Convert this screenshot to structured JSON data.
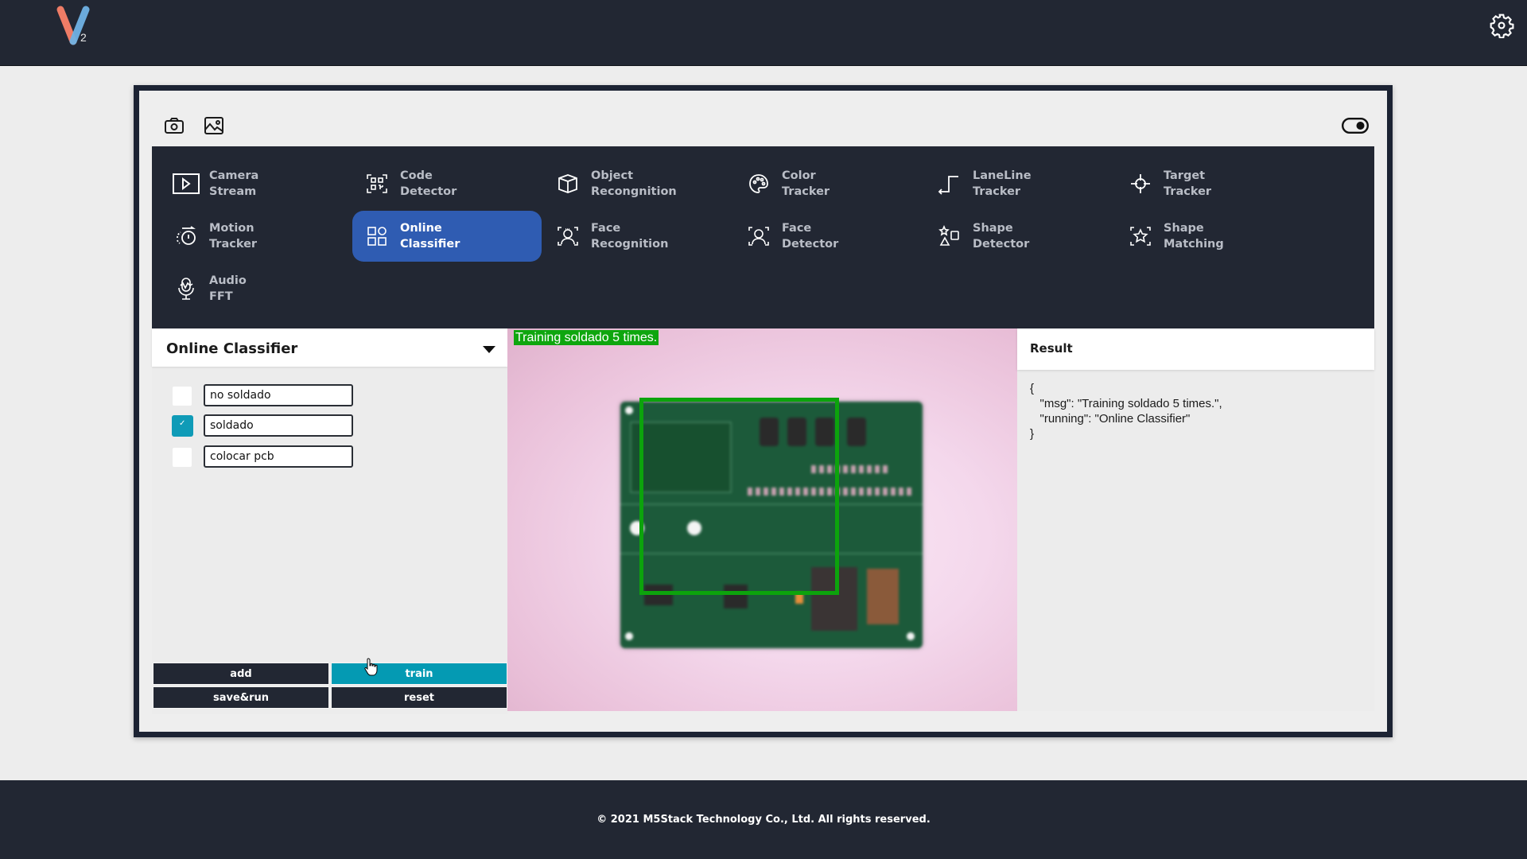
{
  "app": {
    "logo_letter": "V",
    "logo_sub": "2",
    "colors": {
      "topbar": "#222733",
      "accent_active": "#2f5cb2",
      "accent_teal": "#049ab3",
      "detect_green": "#0ca30c"
    }
  },
  "header": {
    "settings_icon": "gear-icon"
  },
  "toolbar": {
    "icons": [
      "camera-icon",
      "image-icon"
    ],
    "toggle_icon": "toggle-icon"
  },
  "menu": {
    "items": [
      {
        "label": "Camera\nStream",
        "icon": "play-screen-icon",
        "active": false
      },
      {
        "label": "Code\nDetector",
        "icon": "qr-code-icon",
        "active": false
      },
      {
        "label": "Object\nRecongnition",
        "icon": "cube-icon",
        "active": false
      },
      {
        "label": "Color\nTracker",
        "icon": "palette-icon",
        "active": false
      },
      {
        "label": "LaneLine\nTracker",
        "icon": "laneline-icon",
        "active": false
      },
      {
        "label": "Target\nTracker",
        "icon": "crosshair-icon",
        "active": false
      },
      {
        "label": "Motion\nTracker",
        "icon": "motion-icon",
        "active": false
      },
      {
        "label": "Online\nClassifier",
        "icon": "grid-shapes-icon",
        "active": true
      },
      {
        "label": "Face\nRecognition",
        "icon": "face-scan-icon",
        "active": false
      },
      {
        "label": "Face\nDetector",
        "icon": "face-detect-icon",
        "active": false
      },
      {
        "label": "Shape\nDetector",
        "icon": "shapes-icon",
        "active": false
      },
      {
        "label": "Shape\nMatching",
        "icon": "star-scan-icon",
        "active": false
      },
      {
        "label": "Audio\nFFT",
        "icon": "microphone-icon",
        "active": false
      }
    ]
  },
  "left_panel": {
    "title": "Online Classifier",
    "classes": [
      {
        "name": "no soldado",
        "checked": false
      },
      {
        "name": "soldado",
        "checked": true
      },
      {
        "name": "colocar pcb",
        "checked": false
      }
    ],
    "buttons": {
      "add": "add",
      "train": "train",
      "save_run": "save&run",
      "reset": "reset"
    }
  },
  "camera": {
    "overlay_text": "Training soldado 5 times."
  },
  "result": {
    "title": "Result",
    "json_text": "{\n   \"msg\": \"Training soldado 5 times.\",\n   \"running\": \"Online Classifier\"\n}"
  },
  "footer": {
    "copyright": "© 2021 M5Stack Technology Co., Ltd. All rights reserved."
  }
}
